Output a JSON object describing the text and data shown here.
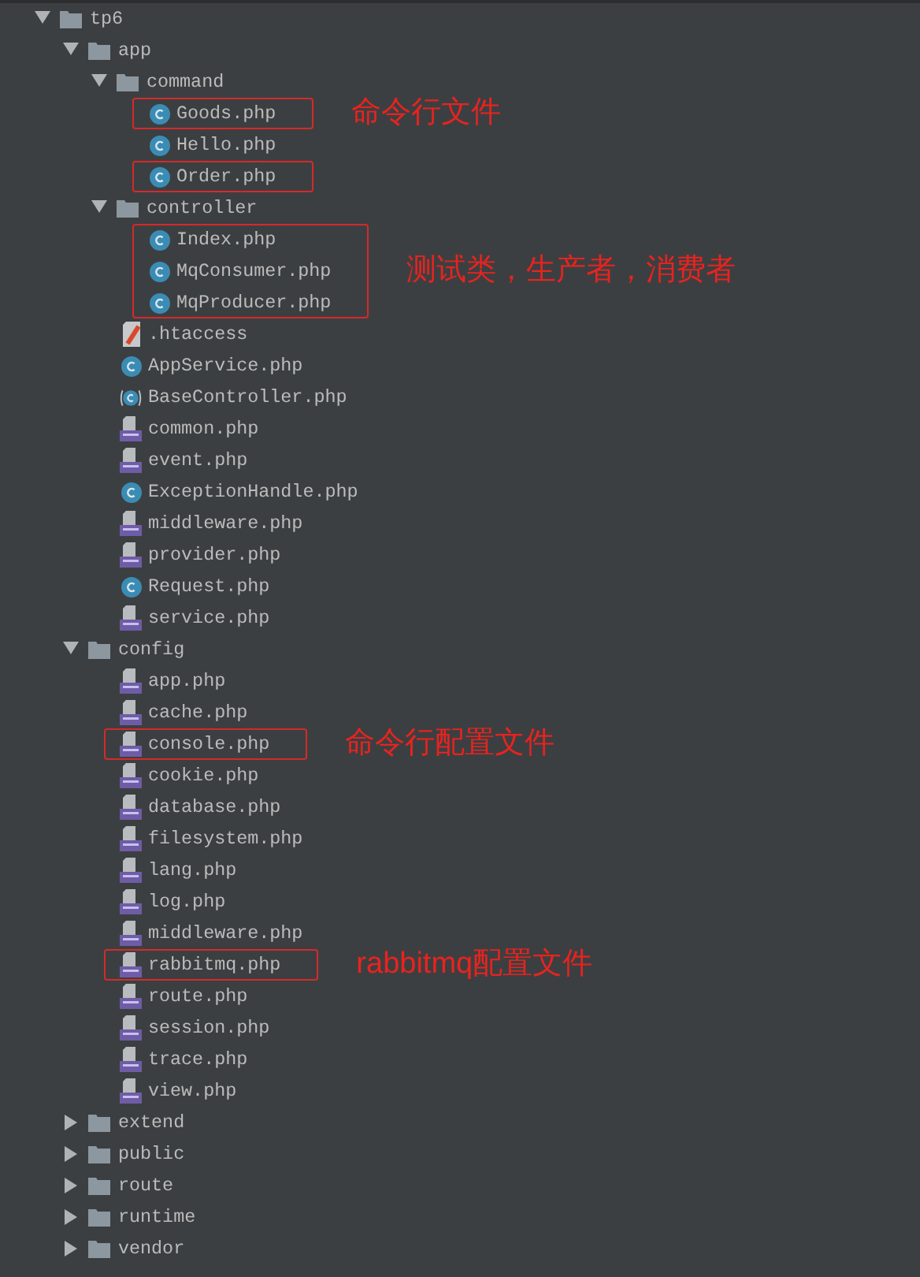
{
  "tree": [
    {
      "kind": "folder",
      "name": "tp6",
      "expanded": true,
      "children": [
        {
          "kind": "folder",
          "name": "app",
          "expanded": true,
          "children": [
            {
              "kind": "folder",
              "name": "command",
              "expanded": true,
              "children": [
                {
                  "kind": "class",
                  "name": "Goods.php",
                  "boxed": true,
                  "note": "命令行文件"
                },
                {
                  "kind": "class",
                  "name": "Hello.php",
                  "boxed": false
                },
                {
                  "kind": "class",
                  "name": "Order.php",
                  "boxed": true
                }
              ]
            },
            {
              "kind": "folder",
              "name": "controller",
              "expanded": true,
              "children": [
                {
                  "kind": "class",
                  "name": "Index.php",
                  "boxed": true,
                  "note": "测试类，生产者，消费者"
                },
                {
                  "kind": "class",
                  "name": "MqConsumer.php",
                  "boxed": true
                },
                {
                  "kind": "class",
                  "name": "MqProducer.php",
                  "boxed": true
                }
              ]
            },
            {
              "kind": "htaccess",
              "name": ".htaccess",
              "boxed": false
            },
            {
              "kind": "class",
              "name": "AppService.php",
              "boxed": false
            },
            {
              "kind": "abstract",
              "name": "BaseController.php",
              "boxed": false
            },
            {
              "kind": "php",
              "name": "common.php",
              "boxed": false
            },
            {
              "kind": "php",
              "name": "event.php",
              "boxed": false
            },
            {
              "kind": "class",
              "name": "ExceptionHandle.php",
              "boxed": false
            },
            {
              "kind": "php",
              "name": "middleware.php",
              "boxed": false
            },
            {
              "kind": "php",
              "name": "provider.php",
              "boxed": false
            },
            {
              "kind": "class",
              "name": "Request.php",
              "boxed": false
            },
            {
              "kind": "php",
              "name": "service.php",
              "boxed": false
            }
          ]
        },
        {
          "kind": "folder",
          "name": "config",
          "expanded": true,
          "children": [
            {
              "kind": "php",
              "name": "app.php",
              "boxed": false
            },
            {
              "kind": "php",
              "name": "cache.php",
              "boxed": false
            },
            {
              "kind": "php",
              "name": "console.php",
              "boxed": true,
              "note": "命令行配置文件"
            },
            {
              "kind": "php",
              "name": "cookie.php",
              "boxed": false
            },
            {
              "kind": "php",
              "name": "database.php",
              "boxed": false
            },
            {
              "kind": "php",
              "name": "filesystem.php",
              "boxed": false
            },
            {
              "kind": "php",
              "name": "lang.php",
              "boxed": false
            },
            {
              "kind": "php",
              "name": "log.php",
              "boxed": false
            },
            {
              "kind": "php",
              "name": "middleware.php",
              "boxed": false
            },
            {
              "kind": "php",
              "name": "rabbitmq.php",
              "boxed": true,
              "note": "rabbitmq配置文件"
            },
            {
              "kind": "php",
              "name": "route.php",
              "boxed": false
            },
            {
              "kind": "php",
              "name": "session.php",
              "boxed": false
            },
            {
              "kind": "php",
              "name": "trace.php",
              "boxed": false
            },
            {
              "kind": "php",
              "name": "view.php",
              "boxed": false
            }
          ]
        },
        {
          "kind": "folder",
          "name": "extend",
          "expanded": false
        },
        {
          "kind": "folder",
          "name": "public",
          "expanded": false
        },
        {
          "kind": "folder",
          "name": "route",
          "expanded": false
        },
        {
          "kind": "folder",
          "name": "runtime",
          "expanded": false
        },
        {
          "kind": "folder",
          "name": "vendor",
          "expanded": false
        }
      ]
    }
  ]
}
